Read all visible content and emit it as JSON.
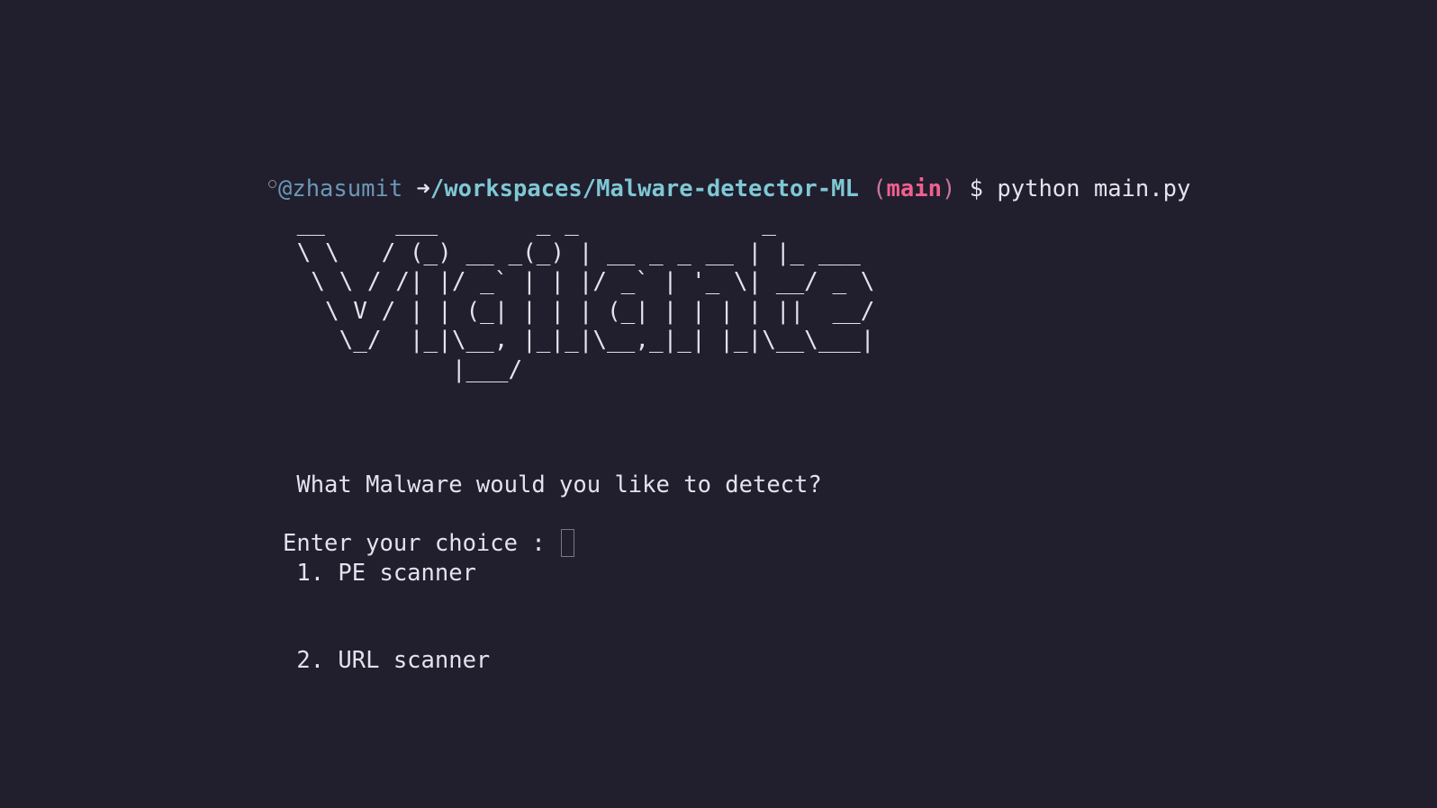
{
  "prompt": {
    "user": "@zhasumit",
    "arrow": "➜",
    "path": "/workspaces/Malware-detector-ML",
    "paren_open": "(",
    "branch": "main",
    "paren_close": ")",
    "dollar": "$",
    "command": "python main.py"
  },
  "banner": {
    "ascii_art": " __     ___       _ _             _\n \\ \\   / (_) __ _(_) | __ _ _ __ | |_ ___\n  \\ \\ / /| |/ _` | | |/ _` | '_ \\| __/ _ \\\n   \\ V / | | (_| | | | (_| | | | | ||  __/\n    \\_/  |_|\\__, |_|_|\\__,_|_| |_|\\__\\___|\n            |___/"
  },
  "menu": {
    "question": " What Malware would you like to detect?",
    "option_1": " 1. PE scanner",
    "option_2": " 2. URL scanner"
  },
  "input": {
    "label": "Enter your choice : ",
    "value": ""
  },
  "colors": {
    "background": "#211e2e",
    "text": "#e4e2ec",
    "user": "#6a98b6",
    "path": "#7ec8d4",
    "branch": "#f0608e"
  }
}
